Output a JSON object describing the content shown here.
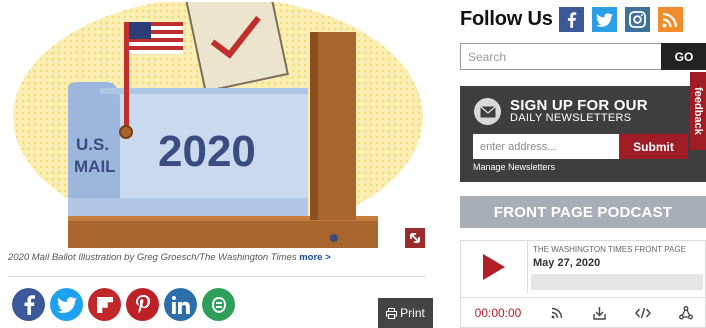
{
  "article": {
    "illustration": {
      "mailbox_text": "U.S.\nMAIL",
      "mailbox_year": "2020"
    },
    "caption": "2020 Mail Ballot Illustration by Greg Groesch/The Washington Times",
    "caption_more": "more >",
    "share_icons": [
      "facebook-icon",
      "twitter-icon",
      "flipboard-icon",
      "pinterest-icon",
      "linkedin-icon",
      "more-share-icon"
    ],
    "print_label": "Print"
  },
  "sidebar": {
    "follow_title": "Follow Us",
    "social_icons": [
      "facebook-icon",
      "twitter-icon",
      "instagram-icon",
      "rss-icon"
    ],
    "search": {
      "placeholder": "Search",
      "go_label": "GO"
    },
    "newsletter": {
      "title": "SIGN UP FOR OUR",
      "subtitle": "DAILY NEWSLETTERS",
      "input_placeholder": "enter address...",
      "submit_label": "Submit",
      "manage_label": "Manage Newsletters"
    },
    "feedback_label": "feedback",
    "podcast": {
      "header": "FRONT PAGE PODCAST",
      "show_name": "THE WASHINGTON TIMES FRONT PAGE",
      "episode_date": "May 27, 2020",
      "time": "00:00:00"
    }
  },
  "colors": {
    "brand_red": "#a01c24",
    "dark_panel": "#3e3e3e",
    "podcast_header": "#a9adb5",
    "facebook": "#3b5998",
    "twitter": "#1da1f2"
  }
}
